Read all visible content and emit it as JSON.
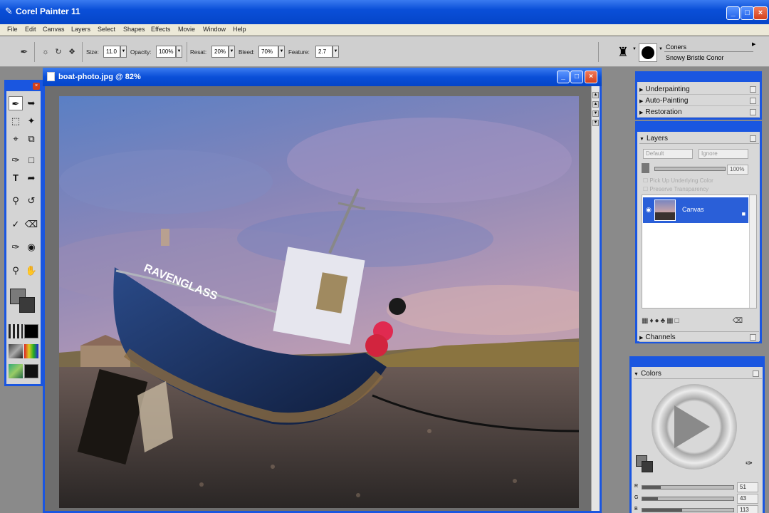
{
  "app": {
    "title": "Corel Painter 11"
  },
  "menu": [
    "File",
    "Edit",
    "Canvas",
    "Layers",
    "Select",
    "Shapes",
    "Effects",
    "Movie",
    "Window",
    "Help"
  ],
  "property_bar": {
    "size": {
      "label": "Size:",
      "value": "11.0"
    },
    "opacity": {
      "label": "Opacity:",
      "value": "100%"
    },
    "resat": {
      "label": "Resat:",
      "value": "20%"
    },
    "bleed": {
      "label": "Bleed:",
      "value": "70%"
    },
    "feature": {
      "label": "Feature:",
      "value": "2.7"
    }
  },
  "brush_selector": {
    "category": "Coners",
    "variant": "Snowy Bristle Conor"
  },
  "document": {
    "title": "boat-photo.jpg @ 82%",
    "boat_name": "RAVENGLASS"
  },
  "panels": {
    "underpainting": {
      "items": [
        "Underpainting",
        "Auto-Painting",
        "Restoration"
      ]
    },
    "layers": {
      "title": "Layers",
      "composite_method": "Default",
      "composite_depth": "Ignore",
      "opacity_value": "100%",
      "pick_up_underlying": "Pick Up Underlying Color",
      "preserve_transparency": "Preserve Transparency",
      "layer_name": "Canvas",
      "channels_label": "Channels"
    },
    "colors": {
      "title": "Colors",
      "rows": [
        {
          "label": "R",
          "value": "51",
          "fraction": 0.2
        },
        {
          "label": "G",
          "value": "43",
          "fraction": 0.17
        },
        {
          "label": "B",
          "value": "113",
          "fraction": 0.44
        }
      ]
    }
  },
  "colors": {
    "title_bar": "#0a4fd8",
    "primary_color": "#7a7a7a",
    "secondary_color": "#3a3a3a"
  }
}
